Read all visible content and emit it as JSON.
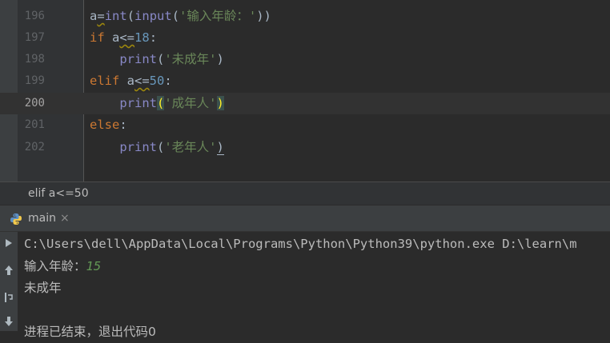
{
  "editor": {
    "lines": [
      {
        "num": "196",
        "code": "a=int(input('输入年龄：'))"
      },
      {
        "num": "197",
        "code": "if a<=18:"
      },
      {
        "num": "198",
        "code": "    print('未成年')"
      },
      {
        "num": "199",
        "code": "elif a<=50:"
      },
      {
        "num": "200",
        "code": "    print('成年人')"
      },
      {
        "num": "201",
        "code": "else:"
      },
      {
        "num": "202",
        "code": "    print('老年人')"
      }
    ],
    "current_line": "200"
  },
  "breadcrumb": {
    "text": "elif a<=50"
  },
  "run_panel": {
    "tab": {
      "label": "main",
      "close": "×"
    },
    "console": {
      "command": "C:\\Users\\dell\\AppData\\Local\\Programs\\Python\\Python39\\python.exe D:\\learn\\m",
      "prompt": "输入年龄：",
      "input": "15",
      "output": "未成年",
      "exit": "进程已结束，退出代码0"
    }
  },
  "colors": {
    "editor_bg": "#2b2b2b",
    "keyword": "#cc7832",
    "builtin": "#8888c6",
    "number": "#6897bb",
    "string": "#6a8759",
    "console_input": "#629755"
  }
}
